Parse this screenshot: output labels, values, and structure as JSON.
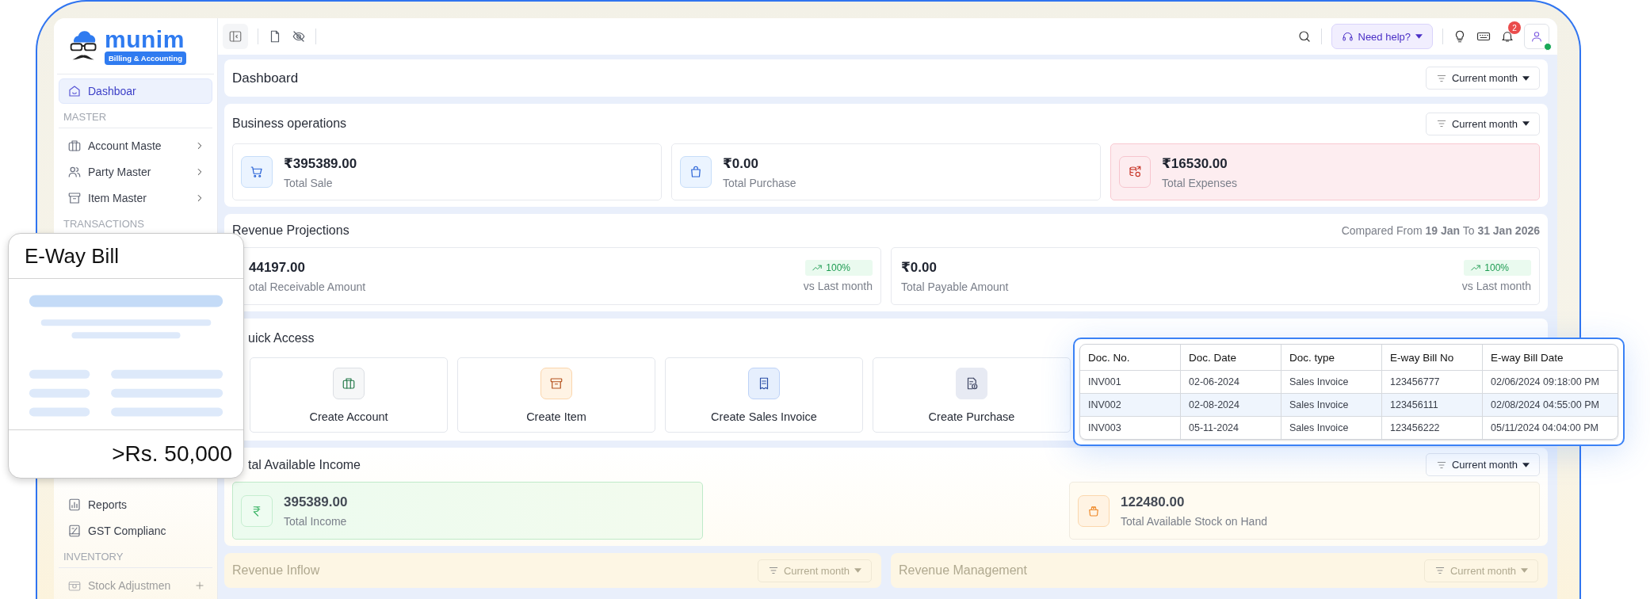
{
  "header": {
    "help_button": "Need help?",
    "notification_count": "2",
    "user_online": true
  },
  "sidebar": {
    "logo": {
      "name": "munim",
      "tagline": "Billing & Accounting"
    },
    "items": [
      {
        "kind": "link",
        "label": "Dashboar",
        "selected": true
      },
      {
        "kind": "heading",
        "label": "MASTER"
      },
      {
        "kind": "group",
        "label": "Account Maste",
        "selected": false
      },
      {
        "kind": "group",
        "label": "Party Master",
        "selected": false
      },
      {
        "kind": "group",
        "label": "Item Master",
        "selected": false
      },
      {
        "kind": "heading",
        "label": "TRANSACTIONS"
      }
    ],
    "lower_items": [
      {
        "kind": "link",
        "label": "Reports",
        "selected": false
      },
      {
        "kind": "link",
        "label": "GST Complianc",
        "selected": false
      },
      {
        "kind": "heading",
        "label": "INVENTORY"
      },
      {
        "kind": "add",
        "label": "Stock Adjustmen",
        "selected": false
      }
    ]
  },
  "dashboard": {
    "title": "Dashboard",
    "filter": "Current month"
  },
  "business_operations": {
    "title": "Business operations",
    "filter": "Current month",
    "cards": [
      {
        "kind": "sale",
        "amount": "₹395389.00",
        "label": "Total Sale"
      },
      {
        "kind": "purchase",
        "amount": "₹0.00",
        "label": "Total Purchase"
      },
      {
        "kind": "expense",
        "amount": "₹16530.00",
        "label": "Total Expenses"
      }
    ]
  },
  "revenue_projections": {
    "title": "Revenue Projections",
    "compared": "Compared From **19 Jan** To **31 Jan 2026**",
    "cards": [
      {
        "amount": "44197.00",
        "label": "otal Receivable Amount",
        "change": "100%",
        "comparison": "vs Last month"
      },
      {
        "amount": "₹0.00",
        "label": "Total Payable Amount",
        "change": "100%",
        "comparison": "vs Last month"
      }
    ]
  },
  "quick_access": {
    "title": "uick Access",
    "items": [
      {
        "kind": "account",
        "label": "Create Account"
      },
      {
        "kind": "item",
        "label": "Create Item"
      },
      {
        "kind": "sales_invoice",
        "label": "Create Sales Invoice"
      },
      {
        "kind": "purchase",
        "label": "Create Purchase"
      }
    ]
  },
  "income": {
    "title": "tal Available Income",
    "filter": "Current month",
    "cards": [
      {
        "kind": "income",
        "amount": "395389.00",
        "label": "Total Income"
      },
      {
        "kind": "stock",
        "amount": "122480.00",
        "label": "Total Available Stock on Hand"
      }
    ]
  },
  "bottom_panels": [
    {
      "title": "Revenue Inflow",
      "filter": "Current month"
    },
    {
      "title": "Revenue Management",
      "filter": "Current month"
    }
  ],
  "eway_card": {
    "title": "E-Way Bill",
    "threshold": ">Rs. 50,000"
  },
  "eway_table": {
    "columns": [
      "Doc. No.",
      "Doc. Date",
      "Doc. type",
      "E-way Bill No",
      "E-way Bill Date"
    ],
    "rows": [
      {
        "selected": false,
        "cells": [
          "INV001",
          "02-06-2024",
          "Sales Invoice",
          "123456777",
          "02/06/2024 09:18:00 PM"
        ]
      },
      {
        "selected": true,
        "cells": [
          "INV002",
          "02-08-2024",
          "Sales Invoice",
          "123456111",
          "02/08/2024 04:55:00 PM"
        ]
      },
      {
        "selected": false,
        "cells": [
          "INV003",
          "05-11-2024",
          "Sales Invoice",
          "123456222",
          "05/11/2024 04:04:00 PM"
        ]
      }
    ]
  }
}
